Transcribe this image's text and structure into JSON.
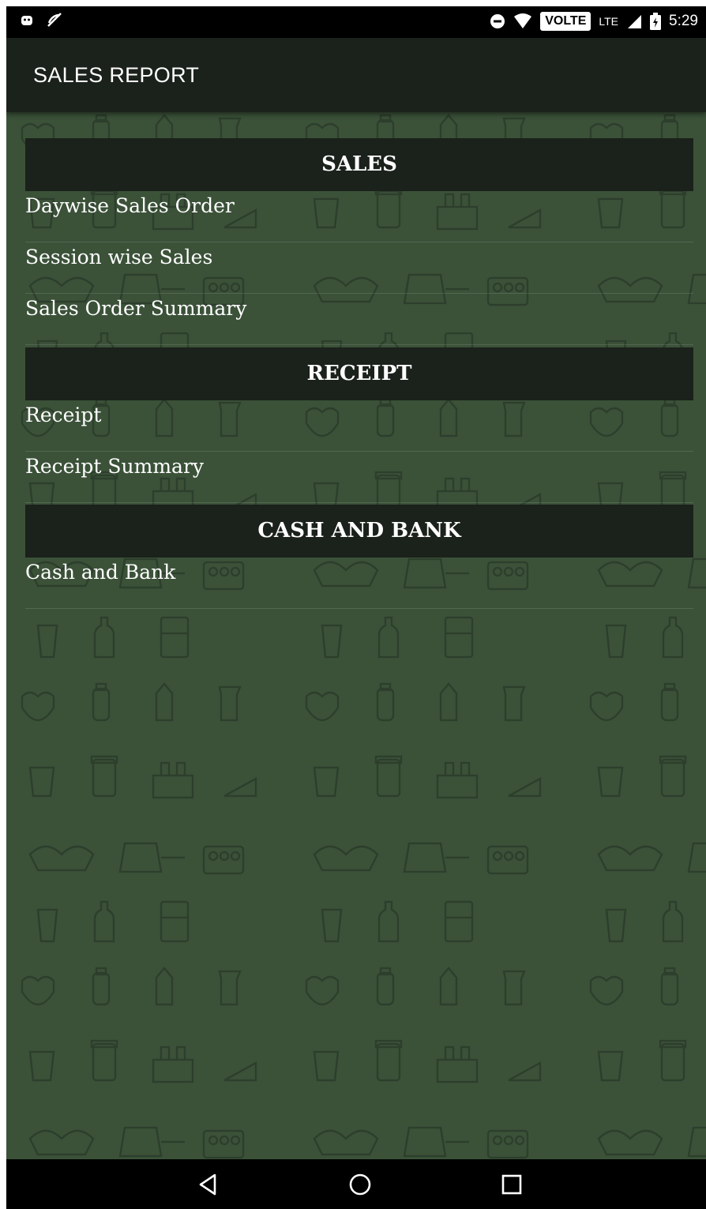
{
  "status_bar": {
    "time": "5:29",
    "network": "VOLTE",
    "signal_type": "LTE",
    "icons_left": [
      "android-debug-icon",
      "no-sync-icon"
    ],
    "icons_right": [
      "do-not-disturb-icon",
      "wifi-icon",
      "signal-icon",
      "battery-icon"
    ]
  },
  "toolbar": {
    "title": "SALES REPORT"
  },
  "sections": [
    {
      "header": "SALES",
      "items": [
        "Daywise Sales Order",
        "Session wise Sales",
        "Sales Order Summary"
      ]
    },
    {
      "header": "RECEIPT",
      "items": [
        "Receipt",
        "Receipt Summary"
      ]
    },
    {
      "header": "CASH AND BANK",
      "items": [
        "Cash and Bank"
      ]
    }
  ],
  "nav_bar": {
    "icons": [
      "back-icon",
      "home-icon",
      "recents-icon"
    ]
  },
  "colors": {
    "background": "#3b5239",
    "header_background": "#1b211b",
    "text": "#ffffff"
  }
}
